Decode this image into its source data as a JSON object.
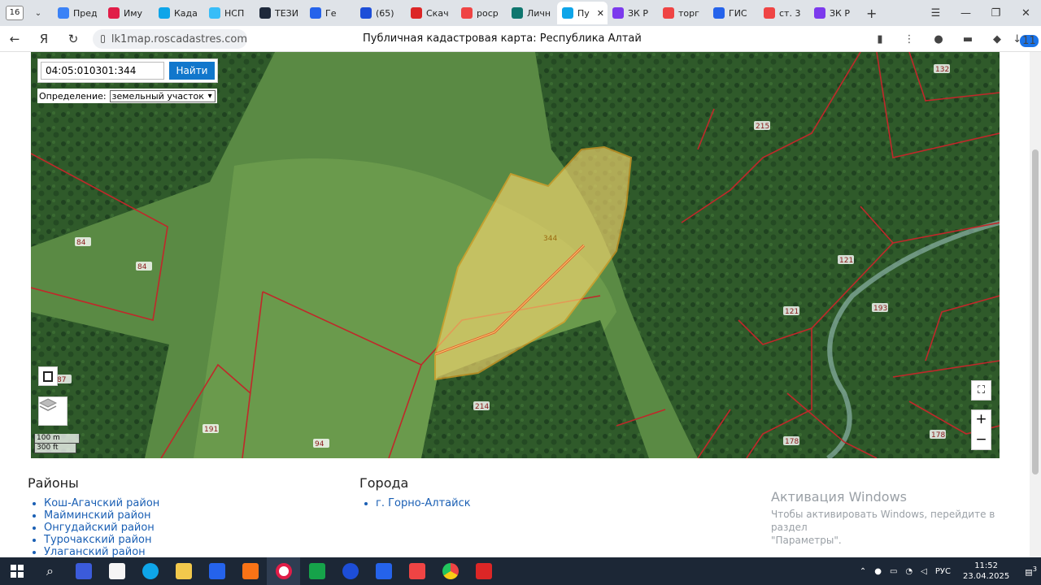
{
  "browser": {
    "tab_count": "16",
    "tabs": [
      {
        "label": "Пред",
        "color": "#3b82f6"
      },
      {
        "label": "Иму",
        "color": "#e11d48"
      },
      {
        "label": "Када",
        "color": "#0ea5e9"
      },
      {
        "label": "НСП",
        "color": "#38bdf8"
      },
      {
        "label": "ТЕЗИ",
        "color": "#1e293b"
      },
      {
        "label": "Ге",
        "color": "#2563eb"
      },
      {
        "label": "(65)",
        "color": "#1d4ed8"
      },
      {
        "label": "Скач",
        "color": "#dc2626"
      },
      {
        "label": "роср",
        "color": "#ef4444"
      },
      {
        "label": "Личн",
        "color": "#0f766e"
      },
      {
        "label": "Пу",
        "color": "#0ea5e9"
      },
      {
        "label": "ЗК Р",
        "color": "#7c3aed"
      },
      {
        "label": "торг",
        "color": "#ef4444"
      },
      {
        "label": "ГИС",
        "color": "#2563eb"
      },
      {
        "label": "ст. 3",
        "color": "#ef4444"
      },
      {
        "label": "ЗК Р",
        "color": "#7c3aed"
      }
    ],
    "active_tab_index": 10,
    "url": "lk1map.roscadastres.com",
    "page_title": "Публичная кадастровая карта: Республика Алтай"
  },
  "map": {
    "search_value": "04:05:010301:344",
    "search_button": "Найти",
    "definition_label": "Определение:",
    "definition_value": "земельный участок",
    "scale_m": "100 m",
    "scale_ft": "300 ft",
    "parcel_label": "344",
    "labels": [
      "132",
      "215",
      "84",
      "84",
      "121",
      "121",
      "193",
      "87",
      "214",
      "191",
      "94",
      "178",
      "178"
    ],
    "zoom_in": "+",
    "zoom_out": "−",
    "parcel_color": "#f5d76e",
    "boundary_color": "#c0282a"
  },
  "content": {
    "districts_title": "Районы",
    "districts": [
      "Кош-Агачский район",
      "Майминский район",
      "Онгудайский район",
      "Турочакский район",
      "Улаганский район"
    ],
    "cities_title": "Города",
    "cities": [
      "г. Горно-Алтайск"
    ]
  },
  "activation": {
    "title": "Активация Windows",
    "line1": "Чтобы активировать Windows, перейдите в раздел",
    "line2": "\"Параметры\"."
  },
  "tray": {
    "lang": "РУС",
    "time": "11:52",
    "date": "23.04.2025",
    "notif_count": "3"
  },
  "ext_badge": "11"
}
